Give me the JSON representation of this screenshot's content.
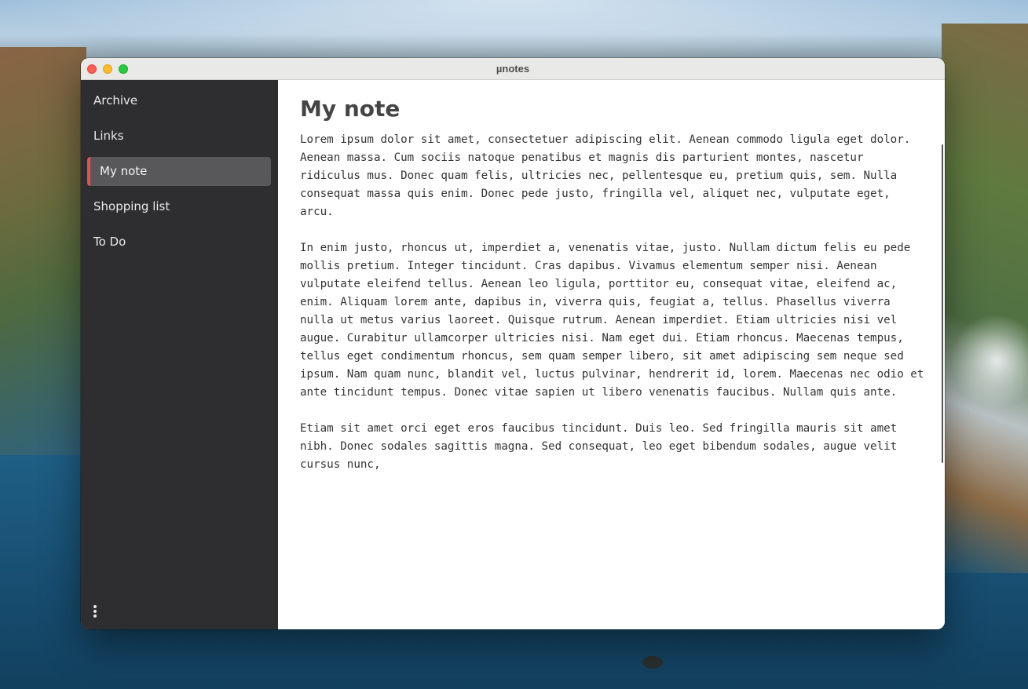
{
  "window": {
    "title": "µnotes"
  },
  "sidebar": {
    "items": [
      {
        "label": "Archive",
        "active": false
      },
      {
        "label": "Links",
        "active": false
      },
      {
        "label": "My note",
        "active": true
      },
      {
        "label": "Shopping list",
        "active": false
      },
      {
        "label": "To Do",
        "active": false
      }
    ],
    "more_icon": "vertical-ellipsis-icon"
  },
  "note": {
    "title": "My note",
    "body": "Lorem ipsum dolor sit amet, consectetuer adipiscing elit. Aenean commodo ligula eget dolor.\nAenean massa. Cum sociis natoque penatibus et magnis dis parturient montes, nascetur\nridiculus mus. Donec quam felis, ultricies nec, pellentesque eu, pretium quis, sem. Nulla\nconsequat massa quis enim. Donec pede justo, fringilla vel, aliquet nec, vulputate eget,\narcu.\n\nIn enim justo, rhoncus ut, imperdiet a, venenatis vitae, justo. Nullam dictum felis eu pede\nmollis pretium. Integer tincidunt. Cras dapibus. Vivamus elementum semper nisi. Aenean\nvulputate eleifend tellus. Aenean leo ligula, porttitor eu, consequat vitae, eleifend ac,\nenim. Aliquam lorem ante, dapibus in, viverra quis, feugiat a, tellus. Phasellus viverra\nnulla ut metus varius laoreet. Quisque rutrum. Aenean imperdiet. Etiam ultricies nisi vel\naugue. Curabitur ullamcorper ultricies nisi. Nam eget dui. Etiam rhoncus. Maecenas tempus,\ntellus eget condimentum rhoncus, sem quam semper libero, sit amet adipiscing sem neque sed\nipsum. Nam quam nunc, blandit vel, luctus pulvinar, hendrerit id, lorem. Maecenas nec odio et\nante tincidunt tempus. Donec vitae sapien ut libero venenatis faucibus. Nullam quis ante.\n\nEtiam sit amet orci eget eros faucibus tincidunt. Duis leo. Sed fringilla mauris sit amet\nnibh. Donec sodales sagittis magna. Sed consequat, leo eget bibendum sodales, augue velit\ncursus nunc,"
  },
  "colors": {
    "sidebar_bg": "#2e2e31",
    "active_item_bg": "#58585b",
    "active_accent": "#e0525d",
    "close": "#fe5f57",
    "minimize": "#febc2e",
    "zoom": "#28c840"
  }
}
